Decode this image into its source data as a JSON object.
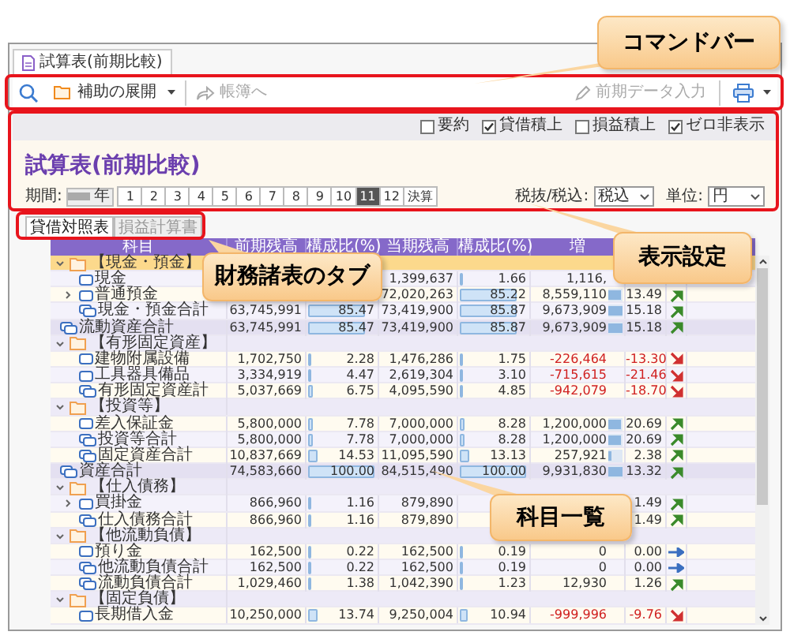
{
  "doc_tab": {
    "title": "試算表(前期比較)"
  },
  "command_bar": {
    "expand_button": {
      "label": "補助の展開"
    },
    "ledger_button": {
      "label": "帳簿へ",
      "disabled": true
    },
    "prior_data_button": {
      "label": "前期データ入力",
      "disabled": true
    }
  },
  "settings": {
    "checkboxes": [
      {
        "label": "要約",
        "checked": false
      },
      {
        "label": "貸借積上",
        "checked": true
      },
      {
        "label": "損益積上",
        "checked": false
      },
      {
        "label": "ゼロ非表示",
        "checked": true
      }
    ],
    "title": "試算表(前期比較)",
    "period": {
      "label": "期間:",
      "year_label": "年",
      "months": [
        {
          "label": "1",
          "selected": false
        },
        {
          "label": "2",
          "selected": false
        },
        {
          "label": "3",
          "selected": false
        },
        {
          "label": "4",
          "selected": false
        },
        {
          "label": "5",
          "selected": false
        },
        {
          "label": "6",
          "selected": false
        },
        {
          "label": "7",
          "selected": false
        },
        {
          "label": "8",
          "selected": false
        },
        {
          "label": "9",
          "selected": false
        },
        {
          "label": "10",
          "selected": false
        },
        {
          "label": "11",
          "selected": true
        },
        {
          "label": "12",
          "selected": false
        },
        {
          "label": "決算",
          "selected": false
        }
      ]
    },
    "tax": {
      "label": "税抜/税込:",
      "value": "税込"
    },
    "unit": {
      "label": "単位:",
      "value": "円"
    }
  },
  "statement_tabs": [
    {
      "label": "貸借対照表",
      "selected": true
    },
    {
      "label": "損益計算書",
      "selected": false
    }
  ],
  "table": {
    "columns": [
      "科目",
      "前期残高",
      "構成比(%)",
      "当期残高",
      "構成比(%)",
      "増"
    ],
    "rows": [
      {
        "kind": "group",
        "label": "【現金・預金】",
        "expanded": true,
        "selected": true,
        "children": [
          {
            "kind": "account",
            "label": "現金",
            "selected": false,
            "curr": "1,399,637",
            "curr_ratio": {
              "text": "1.66",
              "level": 0.0166
            },
            "diff": {
              "text": "1,116,"
            }
          },
          {
            "kind": "account",
            "label": "普通預金",
            "expanded": false,
            "selected": false,
            "curr": "72,020,263",
            "curr_ratio": {
              "text": "85.22",
              "level": 0.8522
            },
            "diff": {
              "text": "8,559,110",
              "level": 0.85
            },
            "diff_ratio": "13.49",
            "arrow": {
              "kind": "up"
            }
          },
          {
            "kind": "subtotal",
            "label": "現金・預金合計",
            "selected": false,
            "prev": "63,745,991",
            "prev_ratio": {
              "text": "85.47",
              "level": 0.8547
            },
            "curr": "73,419,900",
            "curr_ratio": {
              "text": "85.87",
              "level": 0.8587
            },
            "diff": {
              "text": "9,673,909",
              "level": 1
            },
            "diff_ratio": "15.18",
            "arrow": {
              "kind": "up"
            }
          }
        ]
      },
      {
        "kind": "total",
        "label": "流動資産合計",
        "selected": false,
        "prev": "63,745,991",
        "prev_ratio": {
          "text": "85.47",
          "level": 0.8547
        },
        "curr": "73,419,900",
        "curr_ratio": {
          "text": "85.87",
          "level": 0.8587
        },
        "diff": {
          "text": "9,673,909",
          "level": 1
        },
        "diff_ratio": "15.18",
        "arrow": {
          "kind": "up"
        }
      },
      {
        "kind": "group",
        "label": "【有形固定資産】",
        "expanded": true,
        "selected": false,
        "children": [
          {
            "kind": "account",
            "label": "建物附属設備",
            "selected": false,
            "prev": "1,702,750",
            "prev_ratio": {
              "text": "2.28",
              "level": 0.0228
            },
            "curr": "1,476,286",
            "curr_ratio": {
              "text": "1.75",
              "level": 0.0175
            },
            "diff": {
              "text": "-226,464"
            },
            "diff_ratio": "-13.30",
            "arrow": {
              "kind": "down"
            }
          },
          {
            "kind": "account",
            "label": "工具器具備品",
            "selected": false,
            "prev": "3,334,919",
            "prev_ratio": {
              "text": "4.47",
              "level": 0.0447
            },
            "curr": "2,619,304",
            "curr_ratio": {
              "text": "3.10",
              "level": 0.031
            },
            "diff": {
              "text": "-715,615"
            },
            "diff_ratio": "-21.46",
            "arrow": {
              "kind": "down"
            }
          },
          {
            "kind": "subtotal",
            "label": "有形固定資産計",
            "selected": false,
            "prev": "5,037,669",
            "prev_ratio": {
              "text": "6.75",
              "level": 0.0675
            },
            "curr": "4,095,590",
            "curr_ratio": {
              "text": "4.85",
              "level": 0.0485
            },
            "diff": {
              "text": "-942,079"
            },
            "diff_ratio": "-18.70",
            "arrow": {
              "kind": "down"
            }
          }
        ]
      },
      {
        "kind": "group",
        "label": "【投資等】",
        "expanded": true,
        "selected": false,
        "children": [
          {
            "kind": "account",
            "label": "差入保証金",
            "selected": false,
            "prev": "5,800,000",
            "prev_ratio": {
              "text": "7.78",
              "level": 0.0778
            },
            "curr": "7,000,000",
            "curr_ratio": {
              "text": "8.28",
              "level": 0.0828
            },
            "diff": {
              "text": "1,200,000",
              "level": 0.9
            },
            "diff_ratio": "20.69",
            "arrow": {
              "kind": "up"
            }
          },
          {
            "kind": "subtotal",
            "label": "投資等合計",
            "selected": false,
            "prev": "5,800,000",
            "prev_ratio": {
              "text": "7.78",
              "level": 0.0778
            },
            "curr": "7,000,000",
            "curr_ratio": {
              "text": "8.28",
              "level": 0.0828
            },
            "diff": {
              "text": "1,200,000",
              "level": 0.9
            },
            "diff_ratio": "20.69",
            "arrow": {
              "kind": "up"
            }
          },
          {
            "kind": "subtotal",
            "label": "固定資産合計",
            "selected": false,
            "prev": "10,837,669",
            "prev_ratio": {
              "text": "14.53",
              "level": 0.1453
            },
            "curr": "11,095,590",
            "curr_ratio": {
              "text": "13.13",
              "level": 0.1313
            },
            "diff": {
              "text": "257,921",
              "level": 0.2
            },
            "diff_ratio": "2.38",
            "arrow": {
              "kind": "up"
            }
          }
        ]
      },
      {
        "kind": "total",
        "label": "資産合計",
        "selected": false,
        "prev": "74,583,660",
        "prev_ratio": {
          "text": "100.00",
          "level": 1
        },
        "curr": "84,515,490",
        "curr_ratio": {
          "text": "100.00",
          "level": 1
        },
        "diff": {
          "text": "9,931,830",
          "level": 1
        },
        "diff_ratio": "13.32",
        "arrow": {
          "kind": "up"
        }
      },
      {
        "kind": "group",
        "label": "【仕入債務】",
        "expanded": true,
        "selected": false,
        "children": [
          {
            "kind": "account",
            "label": "買掛金",
            "expanded": false,
            "selected": false,
            "prev": "866,960",
            "prev_ratio": {
              "text": "1.16",
              "level": 0.0116
            },
            "curr": "879,890",
            "diff_ratio": "1.49",
            "arrow": {
              "kind": "up"
            }
          },
          {
            "kind": "subtotal",
            "label": "仕入債務合計",
            "selected": false,
            "prev": "866,960",
            "prev_ratio": {
              "text": "1.16",
              "level": 0.0116
            },
            "curr": "879,890",
            "diff_ratio": "1.49",
            "arrow": {
              "kind": "up"
            }
          }
        ]
      },
      {
        "kind": "group",
        "label": "【他流動負債】",
        "expanded": true,
        "selected": false,
        "children": [
          {
            "kind": "account",
            "label": "預り金",
            "selected": false,
            "prev": "162,500",
            "prev_ratio": {
              "text": "0.22",
              "level": 0.0022
            },
            "curr": "162,500",
            "curr_ratio": {
              "text": "0.19",
              "level": 0.0019
            },
            "diff": {
              "text": "0"
            },
            "diff_ratio": "0.00",
            "arrow": {
              "kind": "flat"
            }
          },
          {
            "kind": "subtotal",
            "label": "他流動負債合計",
            "selected": false,
            "prev": "162,500",
            "prev_ratio": {
              "text": "0.22",
              "level": 0.0022
            },
            "curr": "162,500",
            "curr_ratio": {
              "text": "0.19",
              "level": 0.0019
            },
            "diff": {
              "text": "0"
            },
            "diff_ratio": "0.00",
            "arrow": {
              "kind": "flat"
            }
          },
          {
            "kind": "subtotal",
            "label": "流動負債合計",
            "selected": false,
            "prev": "1,029,460",
            "prev_ratio": {
              "text": "1.38",
              "level": 0.0138
            },
            "curr": "1,042,390",
            "curr_ratio": {
              "text": "1.23",
              "level": 0.0123
            },
            "diff": {
              "text": "12,930"
            },
            "diff_ratio": "1.26",
            "arrow": {
              "kind": "up"
            }
          }
        ]
      },
      {
        "kind": "group",
        "label": "【固定負債】",
        "expanded": true,
        "selected": false,
        "children": [
          {
            "kind": "account",
            "label": "長期借入金",
            "selected": false,
            "prev": "10,250,000",
            "prev_ratio": {
              "text": "13.74",
              "level": 0.1374
            },
            "curr": "9,250,004",
            "curr_ratio": {
              "text": "10.94",
              "level": 0.1094
            },
            "diff": {
              "text": "-999,996"
            },
            "diff_ratio": "-9.76",
            "arrow": {
              "kind": "down"
            }
          }
        ]
      }
    ]
  },
  "callouts": [
    {
      "text": "コマンドバー"
    },
    {
      "text": "表示設定"
    },
    {
      "text": "財務諸表のタブ"
    },
    {
      "text": "科目一覧"
    }
  ]
}
